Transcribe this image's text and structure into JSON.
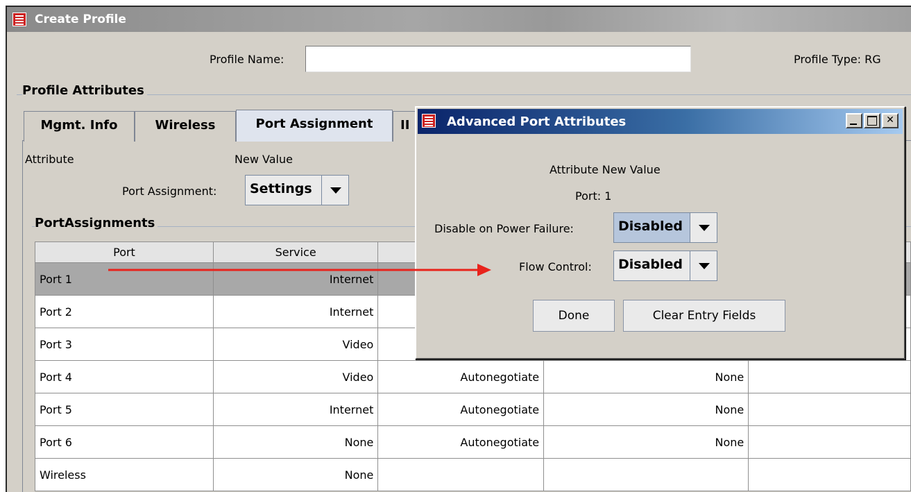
{
  "window": {
    "title": "Create Profile"
  },
  "header": {
    "profile_name_label": "Profile Name:",
    "profile_name_value": "",
    "profile_type_label": "Profile Type:",
    "profile_type_value": "RG"
  },
  "profile_attributes_title": "Profile Attributes",
  "tabs": [
    {
      "label": "Mgmt. Info"
    },
    {
      "label": "Wireless"
    },
    {
      "label": "Port Assignment",
      "active": true
    },
    {
      "label": "II"
    }
  ],
  "port_panel": {
    "attribute_header": "Attribute",
    "new_value_header": "New Value",
    "port_assignment_label": "Port Assignment:",
    "port_assignment_value": "Settings"
  },
  "port_assignments_group": "PortAssignments",
  "table": {
    "columns": [
      "Port",
      "Service",
      "",
      "",
      ""
    ],
    "rows": [
      {
        "port": "Port 1",
        "service": "Internet",
        "c3": "",
        "c4": "",
        "selected": true
      },
      {
        "port": "Port 2",
        "service": "Internet",
        "c3": "",
        "c4": ""
      },
      {
        "port": "Port 3",
        "service": "Video",
        "c3": "",
        "c4": ""
      },
      {
        "port": "Port 4",
        "service": "Video",
        "c3": "Autonegotiate",
        "c4": "None"
      },
      {
        "port": "Port 5",
        "service": "Internet",
        "c3": "Autonegotiate",
        "c4": "None"
      },
      {
        "port": "Port 6",
        "service": "None",
        "c3": "Autonegotiate",
        "c4": "None"
      },
      {
        "port": "Wireless",
        "service": "None",
        "c3": "",
        "c4": ""
      }
    ]
  },
  "dialog": {
    "title": "Advanced Port Attributes",
    "attribute_new_value": "Attribute New Value",
    "port_label": "Port: 1",
    "disable_power_label": "Disable on Power Failure:",
    "disable_power_value": "Disabled",
    "flow_control_label": "Flow Control:",
    "flow_control_value": "Disabled",
    "done_label": "Done",
    "clear_label": "Clear Entry Fields"
  },
  "colors": {
    "annotation_arrow": "#e8231c",
    "dialog_title_start": "#0a246a",
    "dialog_title_end": "#a6caf0"
  }
}
